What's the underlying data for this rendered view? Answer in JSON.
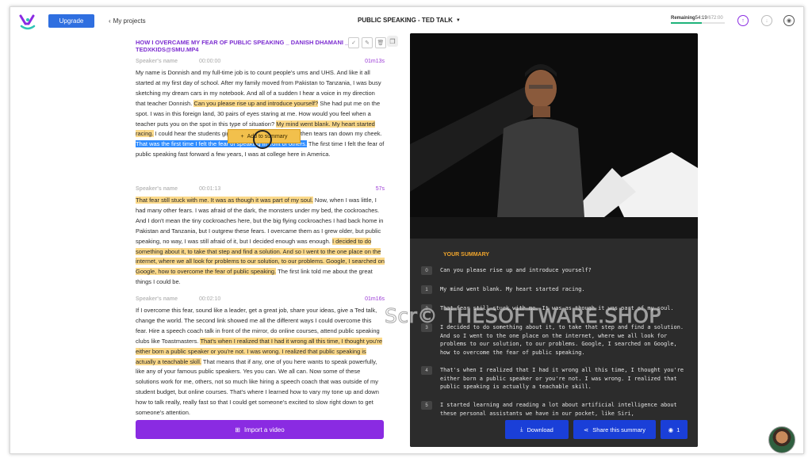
{
  "header": {
    "upgrade_label": "Upgrade",
    "back_label": "My projects",
    "title": "PUBLIC SPEAKING - TED TALK",
    "remaining_label": "Remaining",
    "remaining_value": "54:19",
    "remaining_total": "/672:00",
    "remaining_fraction": 0.58
  },
  "transcript": {
    "file_title": "HOW I OVERCAME MY FEAR OF PUBLIC SPEAKING _ DANISH DHAMANI _ TEDXKIDS@SMU.MP4",
    "speaker_placeholder": "Speaker's name",
    "sections": [
      {
        "timestamp": "00:00:00",
        "duration": "01m13s",
        "segments": [
          {
            "t": "My name is Donnish and my full-time job is to count people's ums and UHS. And like it all started at my first day of school. After my family moved from Pakistan to Tanzania, I was busy sketching my dream cars in my notebook. And all of a sudden I hear a voice in my direction that teacher Donnish. "
          },
          {
            "t": "Can you please rise up and introduce yourself?",
            "h": "hl"
          },
          {
            "t": " She had put me on the spot. I was in this foreign land, 30 pairs of eyes staring at me. How would you feel when a teacher puts you on the spot in this type of situation? "
          },
          {
            "t": "My mind went blank. My heart started racing.",
            "h": "hl"
          },
          {
            "t": " I could hear the students giggling in the classroom and then tears ran down my cheek. "
          },
          {
            "t": "That was the first time I felt the fear of speaking in front of others.",
            "h": "sel"
          },
          {
            "t": " The first time I felt the fear of public speaking fast forward a few years, I was at college here in America."
          }
        ]
      },
      {
        "timestamp": "00:01:13",
        "duration": "57s",
        "segments": [
          {
            "t": "That fear still stuck with me. It was as though it was part of my soul.",
            "h": "hl"
          },
          {
            "t": " Now, when I was little, I had many other fears. I was afraid of the dark, the monsters under my bed, the cockroaches. And I don't mean the tiny cockroaches here, but the big flying cockroaches I had back home in Pakistan and Tanzania, but I outgrew these fears. I overcame them as I grew older, but public speaking, no way, I was still afraid of it, but I decided enough was enough. "
          },
          {
            "t": "I decided to do something about it, to take that step and find a solution. And so I went to the one place on the internet, where we all look for problems to our solution, to our problems. Google, I searched on Google, how to overcome the fear of public speaking.",
            "h": "hl"
          },
          {
            "t": " The first link told me about the great things I could be."
          }
        ]
      },
      {
        "timestamp": "00:02:10",
        "duration": "01m16s",
        "segments": [
          {
            "t": "If I overcome this fear, sound like a leader, get a great job, share your ideas, give a Ted talk, change the world. The second link showed me all the different ways I could overcome this fear. Hire a speech coach talk in front of the mirror, do online courses, attend public speaking clubs like Toastmasters. "
          },
          {
            "t": "That's when I realized that I had it wrong all this time, I thought you're either born a public speaker or you're not. I was wrong. I realized that public speaking is actually a teachable skill.",
            "h": "hl"
          },
          {
            "t": " That means that if any, one of you here wants to speak powerfully, like any of your famous public speakers. Yes you can. We all can. Now some of these solutions work for me, others, not so much like hiring a speech coach that was outside of my student budget, but online courses. That's where I learned how to vary my tone up and down how to talk really, really fast so that I could get someone's excited to slow right down to get someone's attention."
          }
        ]
      }
    ],
    "add_summary_label": "Add to summary",
    "import_label": "Import a video"
  },
  "summary": {
    "heading": "YOUR SUMMARY",
    "items": [
      {
        "num": "0",
        "text": "Can you please rise up and introduce yourself?"
      },
      {
        "num": "1",
        "text": "My mind went blank. My heart started racing."
      },
      {
        "num": "2",
        "text": "That fear still stuck with me. It was as though it was part of my soul."
      },
      {
        "num": "3",
        "text": "I decided to do something about it, to take that step and find a solution. And so I went to the one place on the internet, where we all look for problems to our solution, to our problems. Google, I searched on Google, how to overcome the fear of public speaking."
      },
      {
        "num": "4",
        "text": "That's when I realized that I had it wrong all this time, I thought you're either born a public speaker or you're not. I was wrong. I realized that public speaking is actually a teachable skill."
      },
      {
        "num": "5",
        "text": "I started learning and reading a lot about artificial intelligence about these personal assistants we have in our pocket, like Siri,"
      }
    ],
    "download_label": "Download",
    "share_label": "Share this summary",
    "views_count": "1"
  },
  "watermark": "Scr© THESOFTWARE.SHOP",
  "colors": {
    "accent_purple": "#8a2be2",
    "highlight_yellow": "#fbd98a",
    "selection_blue": "#2f8cff",
    "primary_blue": "#1a3fd8",
    "summary_heading": "#f0a52c"
  }
}
